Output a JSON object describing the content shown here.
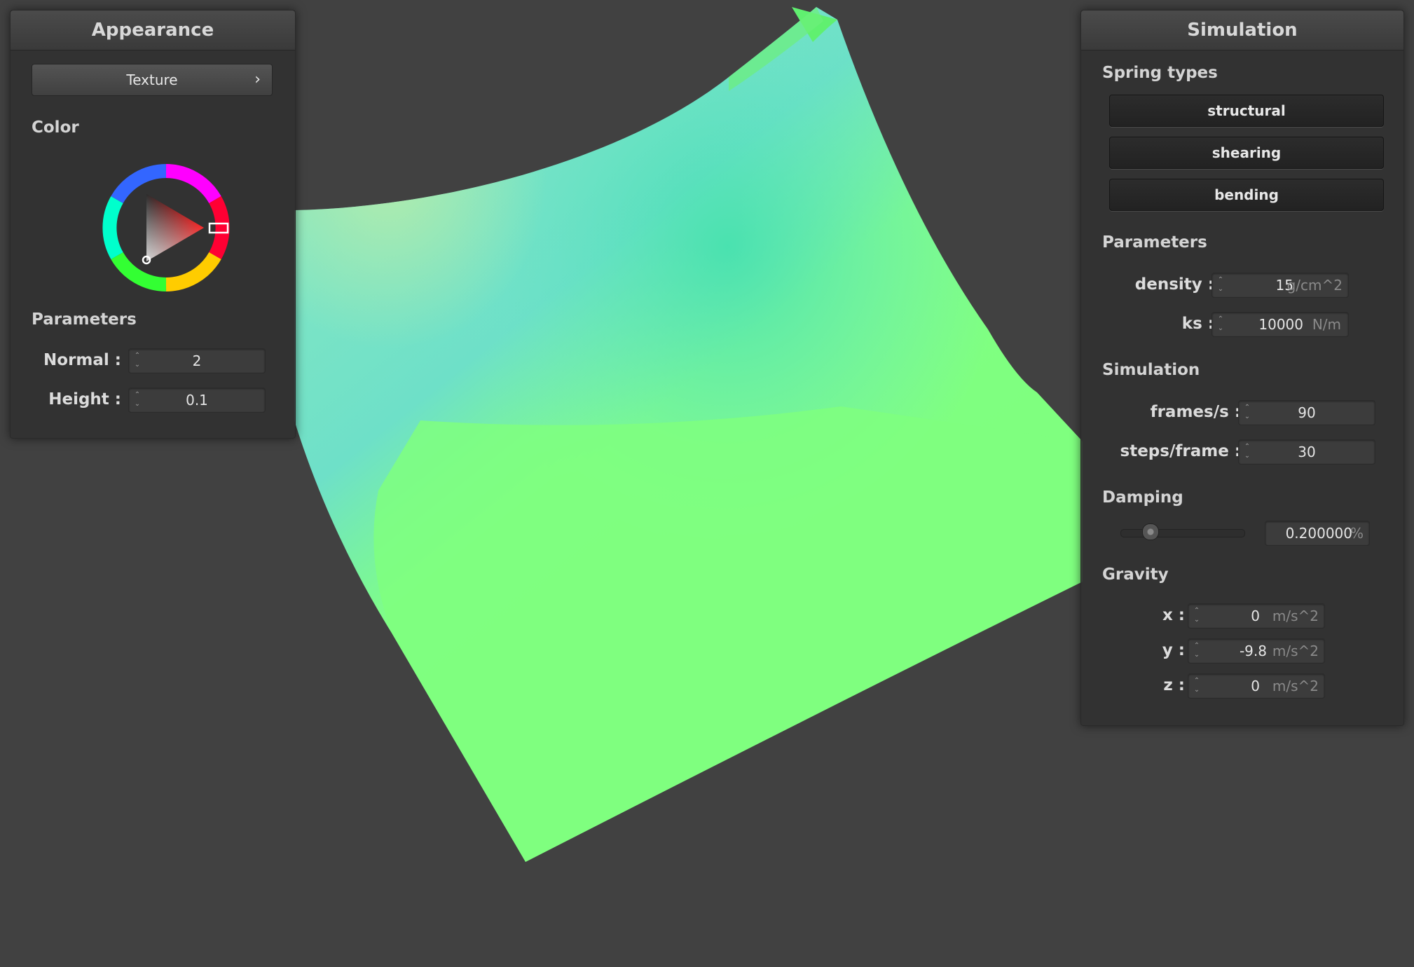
{
  "appearance": {
    "title": "Appearance",
    "texture_button": "Texture",
    "texture_chevron": "›",
    "color_label": "Color",
    "color_wheel": {
      "selected_hue": "#ff0000"
    },
    "parameters_label": "Parameters",
    "normal_label": "Normal :",
    "normal_value": "2",
    "height_label": "Height :",
    "height_value": "0.1"
  },
  "simulation": {
    "title": "Simulation",
    "spring_types_label": "Spring types",
    "spring_buttons": [
      "structural",
      "shearing",
      "bending"
    ],
    "parameters_label": "Parameters",
    "density_label": "density :",
    "density_value": "15",
    "density_unit": "g/cm^2",
    "ks_label": "ks :",
    "ks_value": "10000",
    "ks_unit": "N/m",
    "simulation_label": "Simulation",
    "fps_label": "frames/s :",
    "fps_value": "90",
    "steps_label": "steps/frame :",
    "steps_value": "30",
    "damping_label": "Damping",
    "damping_value": "0.200000",
    "damping_unit": "%",
    "damping_slider_fraction": 0.2,
    "gravity_label": "Gravity",
    "gx_label": "x :",
    "gx_value": "0",
    "gy_label": "y :",
    "gy_value": "-9.8",
    "gz_label": "z :",
    "gz_value": "0",
    "gravity_unit": "m/s^2"
  },
  "colors": {
    "background": "#414141",
    "cloth_green": "#7fff7f",
    "cloth_cyan": "#66ddcc"
  }
}
